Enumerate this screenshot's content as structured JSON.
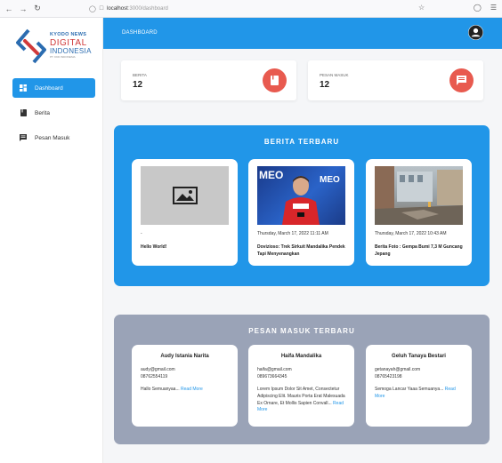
{
  "browser": {
    "url_host": "localhost",
    "url_path": ":3000/dashboard"
  },
  "sidebar": {
    "logo": {
      "line1": "KYODO NEWS",
      "line2": "DIGITAL",
      "line3": "INDONESIA",
      "line4": "PT. KKD INDONESIA"
    },
    "items": [
      {
        "label": "Dashboard",
        "icon": "dashboard-icon",
        "active": true
      },
      {
        "label": "Berita",
        "icon": "book-icon",
        "active": false
      },
      {
        "label": "Pesan Masuk",
        "icon": "message-icon",
        "active": false
      }
    ]
  },
  "header": {
    "title": "DASHBOARD"
  },
  "stats": [
    {
      "label": "BERITA",
      "value": "12",
      "icon": "book-icon"
    },
    {
      "label": "PESAN MASUK",
      "value": "12",
      "icon": "message-icon"
    }
  ],
  "news": {
    "title": "BERITA TERBARU",
    "items": [
      {
        "date": "-",
        "title": "Hello World!",
        "image": "placeholder-image"
      },
      {
        "date": "Thursday, March 17, 2022 11:11 AM",
        "title": "Dovizioso: Trek Sirkuit Mandalika Pendek Tapi Menyenangkan",
        "image": "rider-photo"
      },
      {
        "date": "Thursday, March 17, 2022 10:43 AM",
        "title": "Berita Foto : Gempa Bumi 7,3 M Guncang Jepang",
        "image": "earthquake-photo"
      }
    ]
  },
  "messages": {
    "title": "PESAN MASUK TERBARU",
    "read_more": "Read More",
    "items": [
      {
        "name": "Audy Istania Narita",
        "email": "audy@gmail.com",
        "phone": "08762554119",
        "body": "Hallo Semuanyaa..."
      },
      {
        "name": "Haifa Mandalika",
        "email": "haifa@gmail.com",
        "phone": "089673664345",
        "body": "Lorem Ipsum Dolor Sit Amet, Consectetur Adipiscing Elit. Mauris Porta Erat Malesuada Ex Ornare, Et Mollis Sapien Convall..."
      },
      {
        "name": "Geluh Tanaya Bestari",
        "email": "getanayah@gmail.com",
        "phone": "08765423198",
        "body": "Semoga Lancar Yaaa Semuanya..."
      }
    ]
  },
  "colors": {
    "primary": "#2196e8",
    "accent": "#e85a4f",
    "panel_gray": "#9aa3b7"
  }
}
